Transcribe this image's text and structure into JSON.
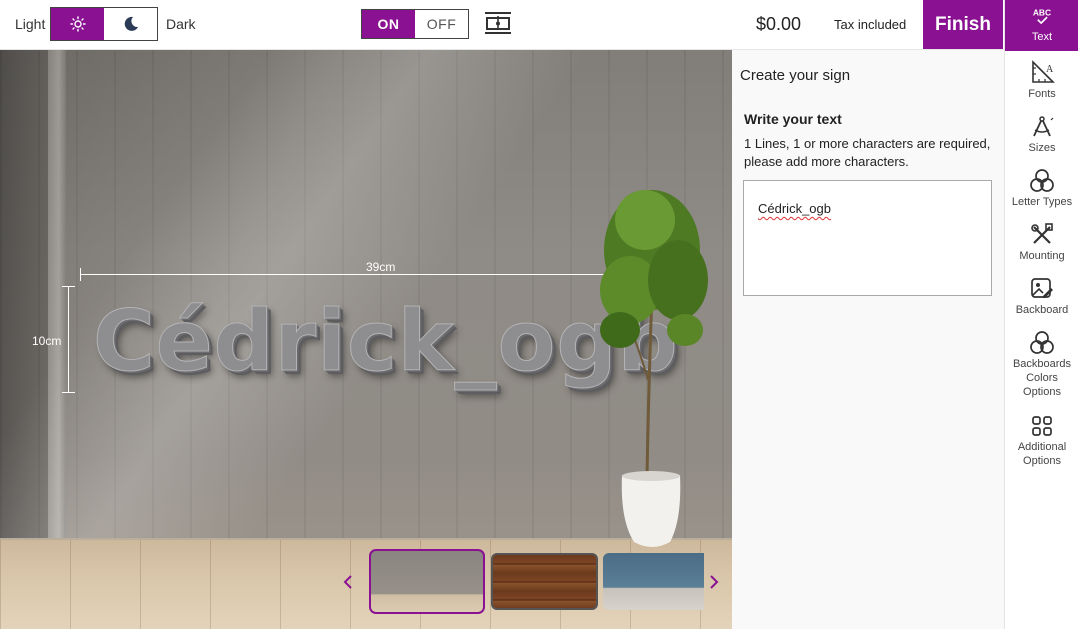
{
  "header": {
    "theme_light_label": "Light",
    "theme_dark_label": "Dark",
    "theme_selected": "light",
    "toggle_on_label": "ON",
    "toggle_off_label": "OFF",
    "toggle_selected": "ON",
    "price": "$0.00",
    "tax_label": "Tax included",
    "finish_label": "Finish"
  },
  "preview": {
    "sign_text": "Cédrick_ogb",
    "width_label": "39cm",
    "height_label": "10cm",
    "backgrounds": [
      {
        "name": "concrete-wall-room",
        "selected": true
      },
      {
        "name": "wood-planks",
        "selected": false
      },
      {
        "name": "blue-room",
        "selected": false
      }
    ]
  },
  "panel": {
    "title": "Create your sign",
    "section_title": "Write your text",
    "hint": "1 Lines, 1 or more characters are required, please add more characters.",
    "text_value": "Cédrick_ogb"
  },
  "sidebar": {
    "items": [
      {
        "label": "Text",
        "icon": "abc-check-icon",
        "active": true
      },
      {
        "label": "Fonts",
        "icon": "ruler-font-icon",
        "active": false
      },
      {
        "label": "Sizes",
        "icon": "compass-icon",
        "active": false
      },
      {
        "label": "Letter Types",
        "icon": "circles-icon",
        "active": false
      },
      {
        "label": "Mounting",
        "icon": "tools-icon",
        "active": false
      },
      {
        "label": "Backboard",
        "icon": "image-edit-icon",
        "active": false
      },
      {
        "label": "Backboards Colors Options",
        "icon": "circles-icon",
        "active": false
      },
      {
        "label": "Additional Options",
        "icon": "grid-icon",
        "active": false
      }
    ]
  },
  "colors": {
    "accent": "#8a1192"
  }
}
